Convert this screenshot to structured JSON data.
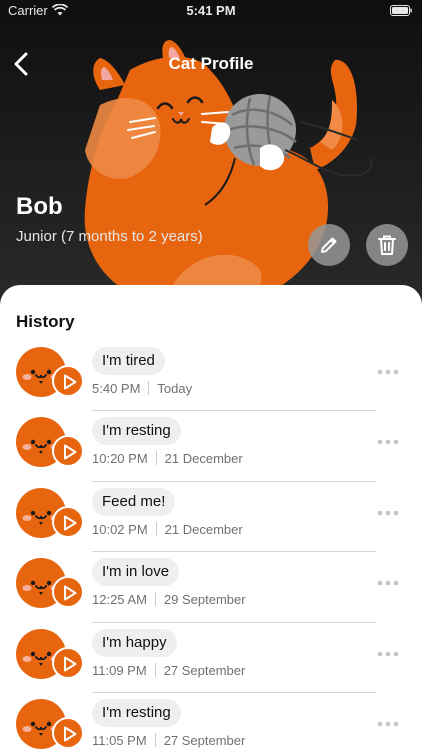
{
  "status_bar": {
    "carrier": "Carrier",
    "time": "5:41 PM"
  },
  "nav": {
    "title": "Cat Profile",
    "back_icon": "chevron-left-icon"
  },
  "profile": {
    "name": "Bob",
    "age_group": "Junior (7 months to 2 years)",
    "edit_icon": "pencil-icon",
    "delete_icon": "trash-icon"
  },
  "history": {
    "title": "History",
    "items": [
      {
        "message": "I'm tired",
        "time": "5:40 PM",
        "date": "Today"
      },
      {
        "message": "I'm resting",
        "time": "10:20 PM",
        "date": "21 December"
      },
      {
        "message": "Feed me!",
        "time": "10:02 PM",
        "date": "21 December"
      },
      {
        "message": "I'm in love",
        "time": "12:25 AM",
        "date": "29 September"
      },
      {
        "message": "I'm happy",
        "time": "11:09 PM",
        "date": "27 September"
      },
      {
        "message": "I'm resting",
        "time": "11:05 PM",
        "date": "27 September"
      }
    ]
  },
  "colors": {
    "accent": "#e8650f",
    "header_bg": "#1f1f1f",
    "sheet_bg": "#ffffff",
    "bubble_bg": "#efefef"
  }
}
